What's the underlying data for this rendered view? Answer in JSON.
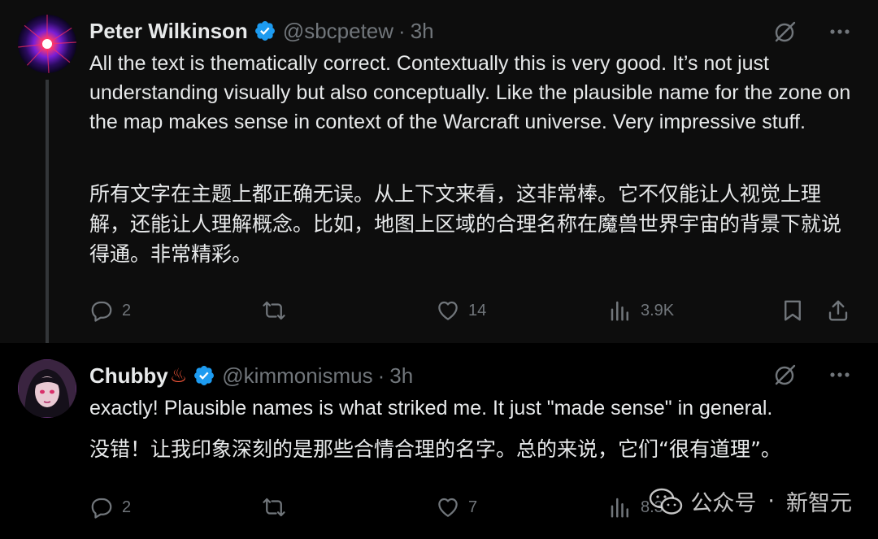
{
  "colors": {
    "background_top": "#0d0d0d",
    "background_bottom": "#000000",
    "text_primary": "#e7e9ea",
    "text_secondary": "#71767b",
    "verified_blue": "#1d9bf0"
  },
  "tweets": [
    {
      "author_name": "Peter Wilkinson",
      "author_emoji": "",
      "handle": "@sbcpetew",
      "separator": "·",
      "time": "3h",
      "text_en": "All the text is thematically correct. Contextually this is very good. It’s not just understanding visually but also conceptually. Like the plausible name for the zone on the map makes sense in context of the Warcraft universe. Very impressive stuff.",
      "text_zh": "所有文字在主题上都正确无误。从上下文来看，这非常棒。它不仅能让人视觉上理解，还能让人理解概念。比如，地图上区域的合理名称在魔兽世界宇宙的背景下就说得通。非常精彩。",
      "replies": "2",
      "likes": "14",
      "views": "3.9K"
    },
    {
      "author_name": "Chubby",
      "author_emoji": "♨",
      "handle": "@kimmonismus",
      "separator": "·",
      "time": "3h",
      "text_en": "exactly! Plausible names is what striked me. It just \"made sense\" in general.",
      "text_zh": "没错！让我印象深刻的是那些合情合理的名字。总的来说，它们“很有道理”。",
      "replies": "2",
      "likes": "7",
      "views": "8.3K"
    }
  ],
  "icons": {
    "reply": "reply-icon",
    "retweet": "retweet-icon",
    "like": "heart-icon",
    "views": "views-icon",
    "bookmark": "bookmark-icon",
    "share": "share-icon",
    "grok": "grok-icon",
    "more": "more-icon",
    "verified": "verified-badge-icon"
  },
  "watermark": {
    "channel": "公众号",
    "separator": "·",
    "brand": "新智元"
  }
}
